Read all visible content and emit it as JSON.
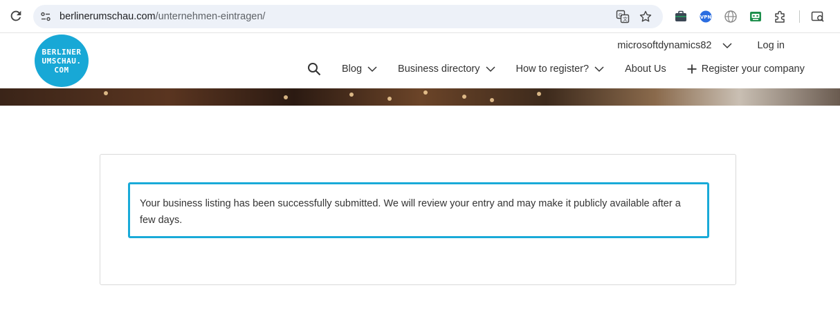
{
  "browser": {
    "url_host": "berlinerumschau.com",
    "url_path": "/unternehmen-eintragen/"
  },
  "site": {
    "logo_lines": [
      "BERLINER",
      "UMSCHAU.",
      "COM"
    ],
    "top_links": {
      "user": "microsoftdynamics82",
      "login": "Log in"
    },
    "nav": {
      "blog": "Blog",
      "directory": "Business directory",
      "howto": "How to register?",
      "about": "About Us",
      "register": "Register your company"
    }
  },
  "main": {
    "notice": "Your business listing has been successfully submitted. We will review your entry and may make it publicly available after a few days."
  },
  "colors": {
    "accent": "#19aad8",
    "logo": "#18a8d6"
  }
}
